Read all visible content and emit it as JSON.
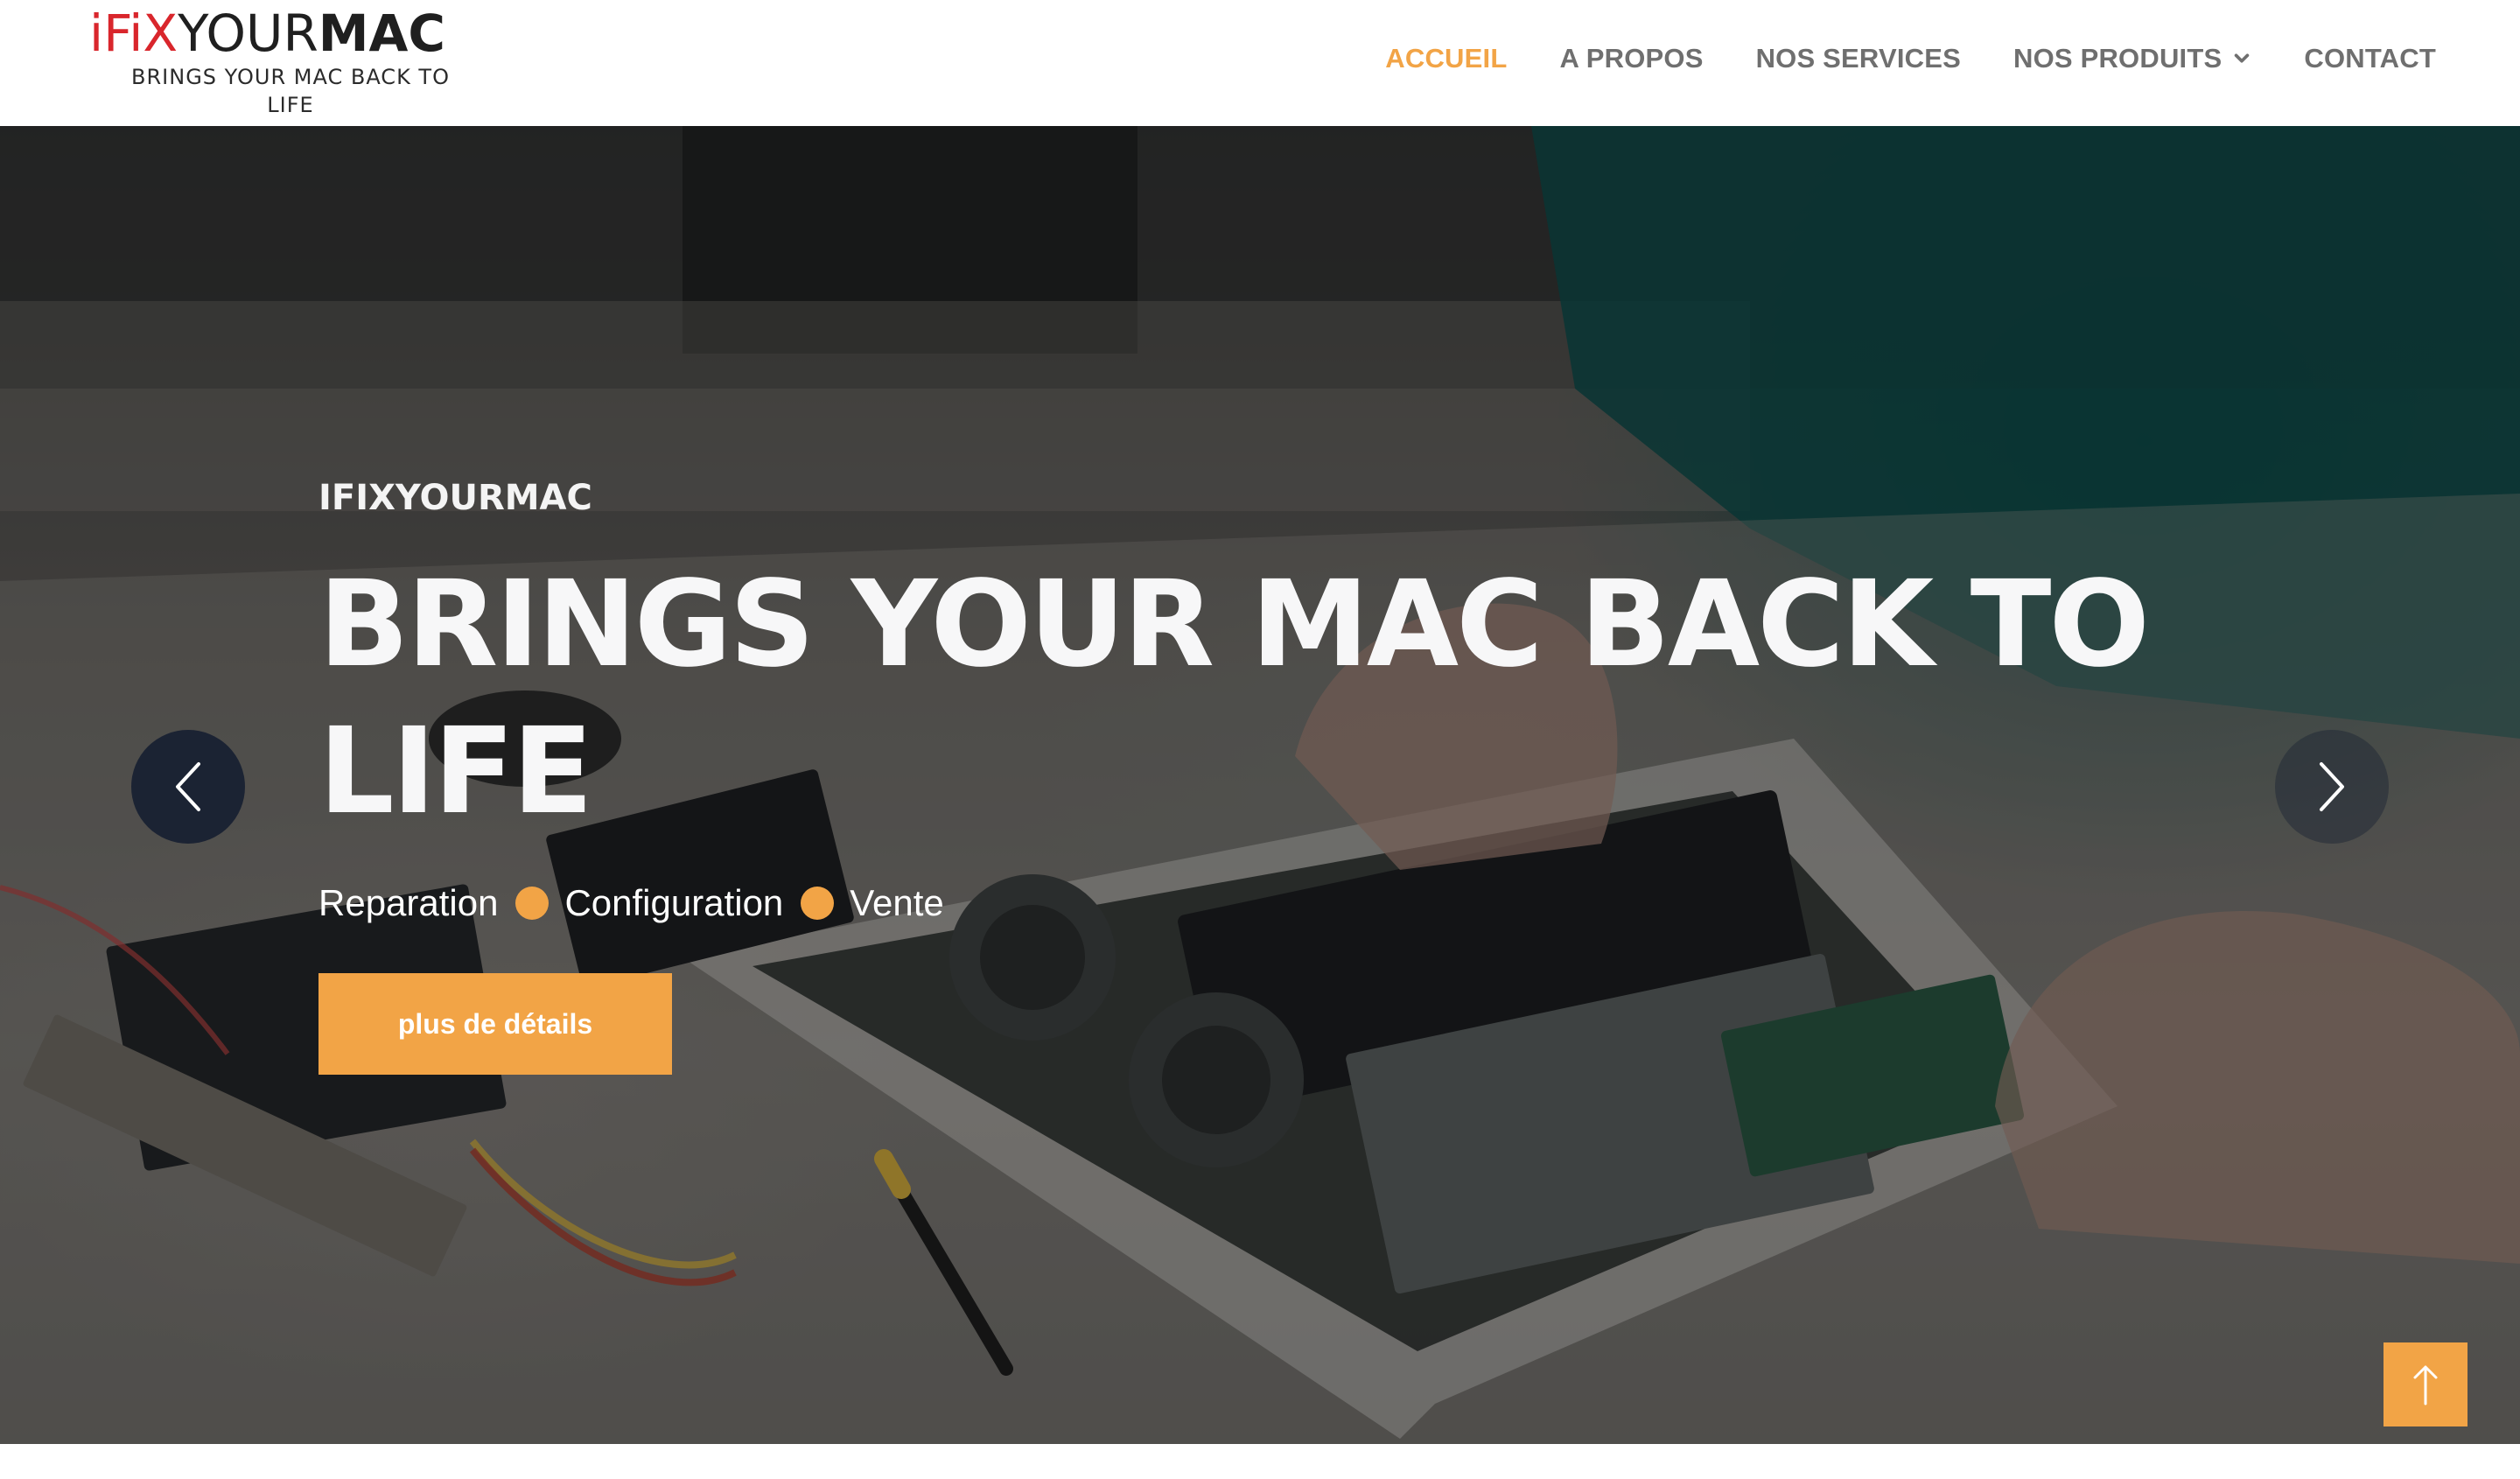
{
  "logo": {
    "prefix": "iFiX",
    "main_regular": "YOUR",
    "main_bold": "MAC",
    "tagline": "BRINGS YOUR MAC BACK TO LIFE"
  },
  "nav": {
    "items": [
      {
        "label": "ACCUEIL",
        "active": true
      },
      {
        "label": "A PROPOS",
        "active": false
      },
      {
        "label": "NOS SERVICES",
        "active": false
      },
      {
        "label": "NOS PRODUITS",
        "active": false,
        "has_dropdown": true
      },
      {
        "label": "CONTACT",
        "active": false
      }
    ]
  },
  "hero": {
    "eyebrow": "IFIXYOURMAC",
    "title": "BRINGS YOUR MAC BACK TO LIFE",
    "tags": [
      "Reparation",
      "Configuration",
      "Vente"
    ],
    "cta_label": "plus de détails"
  },
  "icons": {
    "prev": "chevron-left-icon",
    "next": "chevron-right-icon",
    "scroll_top": "arrow-up-icon",
    "dropdown": "chevron-down-icon"
  },
  "colors": {
    "accent": "#f2a446",
    "nav_text": "#6f6f6f",
    "logo_red": "#d9262c",
    "arrow_bg": "#1b2333",
    "hero_text": "#f7f7f8"
  }
}
